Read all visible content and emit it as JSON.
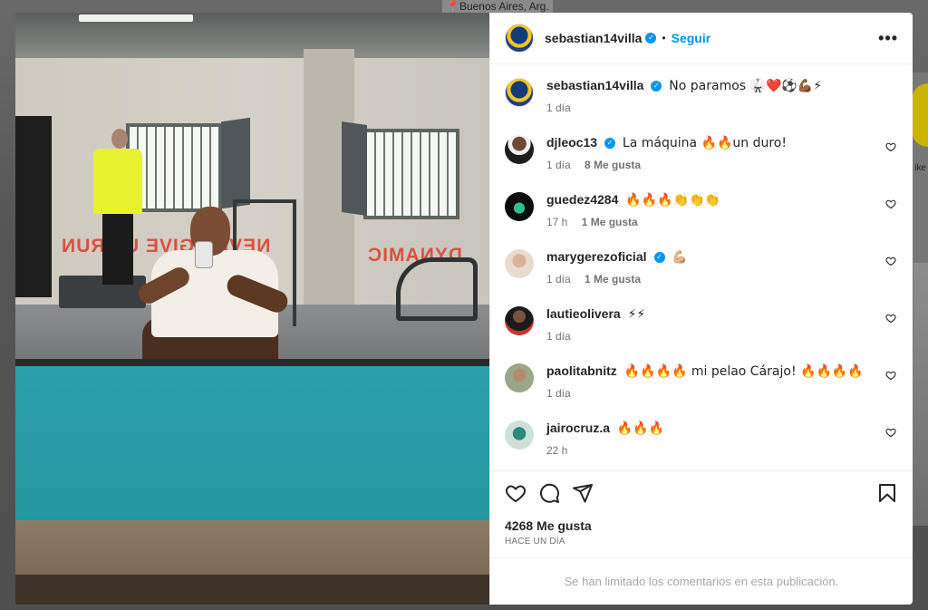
{
  "backdrop": {
    "location": "📍Buenos Aires, Arg.",
    "side_text": "ike"
  },
  "post": {
    "author": "sebastian14villa",
    "follow_label": "Seguir",
    "dot": "•",
    "more_label": "•••",
    "verified_mark": "✓",
    "caption": {
      "user": "sebastian14villa",
      "text": "No paramos 🥋❤️⚽💪🏾⚡",
      "time": "1 día"
    },
    "comments": [
      {
        "user": "djleoc13",
        "verified": true,
        "text": "La máquina 🔥🔥un duro!",
        "time": "1 día",
        "likes": "8 Me gusta"
      },
      {
        "user": "guedez4284",
        "verified": false,
        "text": "🔥🔥🔥👏👏👏",
        "time": "17 h",
        "likes": "1 Me gusta"
      },
      {
        "user": "marygerezoficial",
        "verified": true,
        "text": "💪🏼",
        "time": "1 día",
        "likes": "1 Me gusta"
      },
      {
        "user": "lautieolivera",
        "verified": false,
        "text": "⚡⚡",
        "time": "1 día",
        "likes": ""
      },
      {
        "user": "paolitabnitz",
        "verified": false,
        "text": "🔥🔥🔥🔥 mi pelao Cárajo! 🔥🔥🔥🔥",
        "time": "1 día",
        "likes": ""
      },
      {
        "user": "jairocruz.a",
        "verified": false,
        "text": "🔥🔥🔥",
        "time": "22 h",
        "likes": ""
      }
    ],
    "likes_total": "4268 Me gusta",
    "time_ago": "HACE UN DÍA",
    "comments_limited": "Se han limitado los comentarios en esta publicación."
  },
  "photo": {
    "wall_text_left": "NEVER GIVE UP RUN",
    "wall_text_right": "DYNAMIC"
  },
  "colors": {
    "accent": "#0095f6",
    "muted": "#737373"
  }
}
